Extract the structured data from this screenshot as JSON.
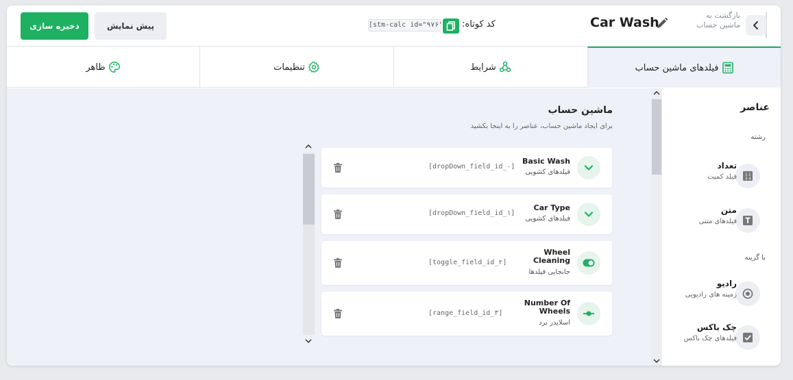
{
  "header": {
    "back_label": "بازگشت به ماشین حساب",
    "calc_title": "Car Wash",
    "shortcode_label": "کد کوتاه:",
    "shortcode_value": "[stm-calc id=\"۹۷۶\"]",
    "preview_label": "پیش نمایش",
    "save_label": "ذخیره سازی"
  },
  "tabs": [
    {
      "label": "فیلدهای ماشین حساب",
      "icon": "calculator-icon",
      "active": true
    },
    {
      "label": "شرایط",
      "icon": "conditions-icon",
      "active": false
    },
    {
      "label": "تنظیمات",
      "icon": "gear-icon",
      "active": false
    },
    {
      "label": "ظاهر",
      "icon": "palette-icon",
      "active": false
    }
  ],
  "sidebar": {
    "title": "عناصر",
    "groups": [
      "رشته",
      "با گزینه"
    ],
    "items": [
      {
        "label": "تعداد",
        "desc": "فیلد کمیت",
        "icon": "number-icon"
      },
      {
        "label": "متن",
        "desc": "فیلدهای متنی",
        "icon": "text-icon"
      },
      {
        "label": "رادیو",
        "desc": "زمینه های رادیویی",
        "icon": "radio-icon"
      },
      {
        "label": "چک باکس",
        "desc": "فیلدهای چک باکس",
        "icon": "checkbox-icon"
      }
    ]
  },
  "main": {
    "title": "ماشین حساب",
    "subtitle": "برای ایجاد ماشین حساب، عناصر را به اینجا بکشید",
    "fields": [
      {
        "name": "Basic Wash",
        "type": "فیلدهای کشویی",
        "id": "[dropDown_field_id_۰]",
        "icon": "chevron-down-icon"
      },
      {
        "name": "Car Type",
        "type": "فیلدهای کشویی",
        "id": "[dropDown_field_id_۱]",
        "icon": "chevron-down-icon"
      },
      {
        "name": "Wheel Cleaning",
        "type": "جابجایی فیلدها",
        "id": "[toggle_field_id_۲]",
        "icon": "toggle-icon"
      },
      {
        "name": "Number Of Wheels",
        "type": "اسلایدر برد",
        "id": "[range_field_id_۳]",
        "icon": "slider-icon"
      }
    ]
  },
  "colors": {
    "accent": "#1db161",
    "panel_bg": "#eef1f7"
  }
}
